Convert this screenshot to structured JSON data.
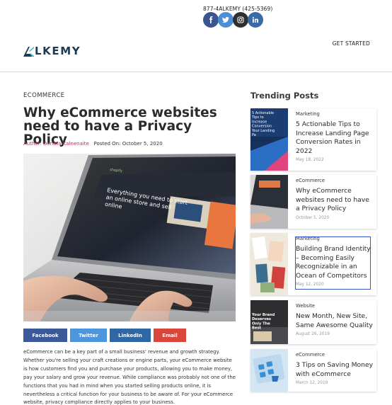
{
  "header": {
    "phone": "877-4ALKEMY (425-5369)",
    "socials": [
      {
        "icon": "facebook-icon",
        "color": "#3b5590"
      },
      {
        "icon": "twitter-icon",
        "color": "#4a8fd6"
      },
      {
        "icon": "instagram-icon",
        "color": "#2f2f2f"
      },
      {
        "icon": "linkedin-icon",
        "color": "#3a6aa8"
      }
    ],
    "logo_text": "LKEMY",
    "get_started": "GET STARTED"
  },
  "article": {
    "category": "ECOMMERCE",
    "title": "Why eCommerce websites need to have a Privacy Policy",
    "author_label": "Author: Donata Kalnenaite",
    "posted_label": "Posted On: October 5, 2020",
    "hero_text": "Everything you need to start an online store and sell online",
    "hero_brand": "shopify",
    "share": [
      {
        "label": "Facebook",
        "color": "#3b5998"
      },
      {
        "label": "Twitter",
        "color": "#4d95dc"
      },
      {
        "label": "LinkedIn",
        "color": "#2f67a5"
      },
      {
        "label": "Email",
        "color": "#d9473a"
      }
    ],
    "body": "eCommerce can be a key part of a small business' revenue and growth strategy. Whether you're selling your craft creations or engine parts, your eCommerce website is how customers find you and purchase your products, allowing you to make money, pay your salary and grow your revenue. While compliance was probably not one of the functions that you had in mind when you started selling products online, it is nevertheless a critical function for your business to be aware of. For your eCommerce website, privacy compliance directly applies to your business."
  },
  "sidebar": {
    "heading": "Trending Posts",
    "posts": [
      {
        "category": "Marketing",
        "title": "5 Actionable Tips to Increase Landing Page Conversion Rates in 2022",
        "date": "May 18, 2022",
        "thumb_text": "5 Actionable Tips to Increase Conversion Your Landing Pa"
      },
      {
        "category": "eCommerce",
        "title": "Why eCommerce websites need to have a Privacy Policy",
        "date": "October 5, 2020"
      },
      {
        "category": "Marketing",
        "title": "Building Brand Identity – Becoming Easily Recognizable in an Ocean of Competitors",
        "date": "May 12, 2020"
      },
      {
        "category": "Website",
        "title": "New Month, New Site, Same Awesome Quality",
        "date": "August 26, 2019",
        "thumb_text": "Your Brand Deserves Only The Best"
      },
      {
        "category": "eCommerce",
        "title": "3 Tips on Saving Money with eCommerce",
        "date": "March 12, 2019"
      }
    ]
  }
}
